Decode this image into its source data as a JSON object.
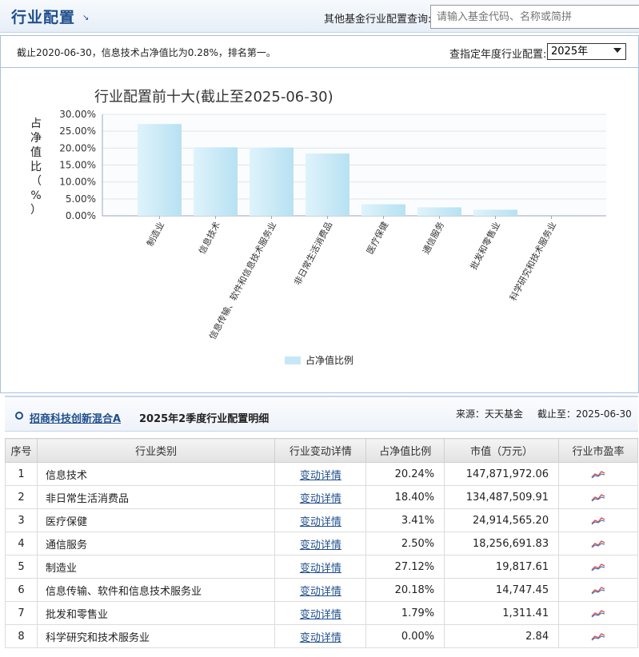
{
  "header": {
    "title": "行业配置",
    "query_label": "其他基金行业配置查询:",
    "query_placeholder": "请输入基金代码、名称或简拼"
  },
  "summary": {
    "note": "截止2020-06-30，信息技术占净值比为0.28%，排名第一。",
    "year_label": "查指定年度行业配置:",
    "year_selected": "2025年"
  },
  "chart_data": {
    "type": "bar",
    "title": "行业配置前十大(截止至2025-06-30)",
    "ylabel": "占净值比（%）",
    "ylim": [
      0,
      30
    ],
    "yticks": [
      "0.00%",
      "5.00%",
      "10.00%",
      "15.00%",
      "20.00%",
      "25.00%",
      "30.00%"
    ],
    "categories": [
      "制造业",
      "信息技术",
      "信息传输、软件和信息技术服务业",
      "非日常生活消费品",
      "医疗保健",
      "通信服务",
      "批发和零售业",
      "科学研究和技术服务业"
    ],
    "series": [
      {
        "name": "占净值比例",
        "values": [
          27.12,
          20.24,
          20.18,
          18.4,
          3.41,
          2.5,
          1.79,
          0.0
        ]
      }
    ],
    "legend_position": "bottom",
    "bar_color": "#c6e8f6"
  },
  "detail": {
    "fund_name": "招商科技创新混合A",
    "title": "2025年2季度行业配置明细",
    "source": "来源：天天基金",
    "as_of": "截止至：2025-06-30",
    "columns": [
      "序号",
      "行业类别",
      "行业变动详情",
      "占净值比例",
      "市值（万元）",
      "行业市盈率"
    ],
    "rows": [
      {
        "no": "1",
        "industry": "信息技术",
        "link": "变动详情",
        "ratio": "20.24%",
        "value": "147,871,972.06"
      },
      {
        "no": "2",
        "industry": "非日常生活消费品",
        "link": "变动详情",
        "ratio": "18.40%",
        "value": "134,487,509.91"
      },
      {
        "no": "3",
        "industry": "医疗保健",
        "link": "变动详情",
        "ratio": "3.41%",
        "value": "24,914,565.20"
      },
      {
        "no": "4",
        "industry": "通信服务",
        "link": "变动详情",
        "ratio": "2.50%",
        "value": "18,256,691.83"
      },
      {
        "no": "5",
        "industry": "制造业",
        "link": "变动详情",
        "ratio": "27.12%",
        "value": "19,817.61"
      },
      {
        "no": "6",
        "industry": "信息传输、软件和信息技术服务业",
        "link": "变动详情",
        "ratio": "20.18%",
        "value": "14,747.45"
      },
      {
        "no": "7",
        "industry": "批发和零售业",
        "link": "变动详情",
        "ratio": "1.79%",
        "value": "1,311.41"
      },
      {
        "no": "8",
        "industry": "科学研究和技术服务业",
        "link": "变动详情",
        "ratio": "0.00%",
        "value": "2.84"
      }
    ]
  }
}
